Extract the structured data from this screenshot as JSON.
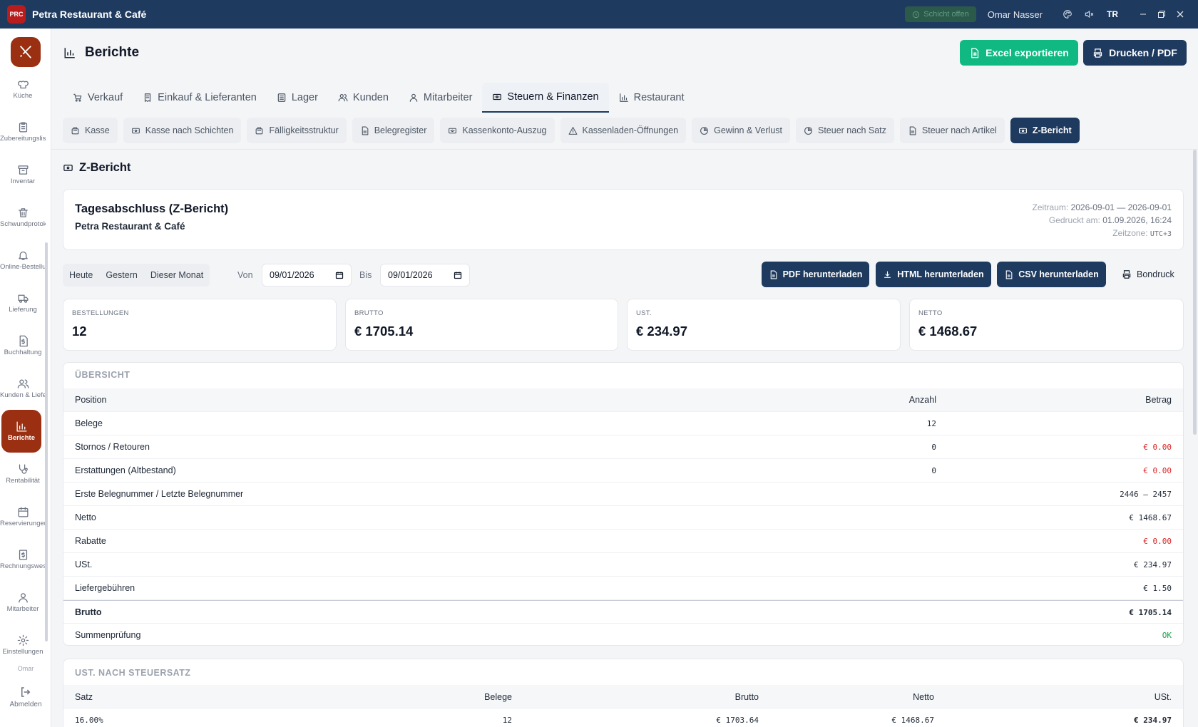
{
  "titlebar": {
    "logo": "PRC",
    "app_title": "Petra Restaurant & Café",
    "shift_status": "Schicht offen",
    "user": "Omar Nasser",
    "lang": "TR"
  },
  "sidebar": {
    "items": [
      {
        "label": "Küche",
        "icon": "chef-hat-icon"
      },
      {
        "label": "Zubereitungsliste",
        "icon": "clipboard-icon"
      },
      {
        "label": "Inventar",
        "icon": "archive-icon"
      },
      {
        "label": "Schwundprotokoll",
        "icon": "trash-icon"
      },
      {
        "label": "Online-Bestellungen",
        "icon": "bell-icon"
      },
      {
        "label": "Lieferung",
        "icon": "truck-icon"
      },
      {
        "label": "Buchhaltung",
        "icon": "dollar-doc-icon"
      },
      {
        "label": "Kunden & Lieferanten",
        "icon": "users-icon"
      },
      {
        "label": "Berichte",
        "icon": "bar-chart-icon",
        "active": true
      },
      {
        "label": "Rentabilität",
        "icon": "stethoscope-icon"
      },
      {
        "label": "Reservierungen",
        "icon": "calendar-icon"
      },
      {
        "label": "Rechnungswesen",
        "icon": "invoice-icon"
      },
      {
        "label": "Mitarbeiter",
        "icon": "staff-icon"
      },
      {
        "label": "Einstellungen",
        "icon": "gear-icon"
      }
    ],
    "user_short": "Omar",
    "logout": "Abmelden"
  },
  "header": {
    "title": "Berichte",
    "excel_btn": "Excel exportieren",
    "print_btn": "Drucken / PDF"
  },
  "tabs": [
    {
      "label": "Verkauf",
      "icon": "cart-icon"
    },
    {
      "label": "Einkauf & Lieferanten",
      "icon": "receipt-icon"
    },
    {
      "label": "Lager",
      "icon": "box-icon"
    },
    {
      "label": "Kunden",
      "icon": "users-icon"
    },
    {
      "label": "Mitarbeiter",
      "icon": "staff-icon"
    },
    {
      "label": "Steuern & Finanzen",
      "icon": "cash-icon",
      "active": true
    },
    {
      "label": "Restaurant",
      "icon": "bar-chart-icon"
    }
  ],
  "subtabs": [
    {
      "label": "Kasse",
      "icon": "register-icon"
    },
    {
      "label": "Kasse nach Schichten",
      "icon": "cash-icon"
    },
    {
      "label": "Fälligkeitsstruktur",
      "icon": "register-icon"
    },
    {
      "label": "Belegregister",
      "icon": "file-icon"
    },
    {
      "label": "Kassenkonto-Auszug",
      "icon": "cash-icon"
    },
    {
      "label": "Kassenladen-Öffnungen",
      "icon": "warning-icon"
    },
    {
      "label": "Gewinn & Verlust",
      "icon": "pie-icon"
    },
    {
      "label": "Steuer nach Satz",
      "icon": "pie-icon"
    },
    {
      "label": "Steuer nach Artikel",
      "icon": "file-icon"
    },
    {
      "label": "Z-Bericht",
      "icon": "cash-icon",
      "active": true
    }
  ],
  "section_title": "Z-Bericht",
  "report": {
    "title": "Tagesabschluss (Z-Bericht)",
    "subtitle": "Petra Restaurant & Café",
    "period_label": "Zeitraum:",
    "period": "2026-09-01 — 2026-09-01",
    "printed_label": "Gedruckt am:",
    "printed": "01.09.2026, 16:24",
    "tz_label": "Zeitzone:",
    "tz": "UTC+3"
  },
  "filters": {
    "quick": [
      "Heute",
      "Gestern",
      "Dieser Monat"
    ],
    "from_label": "Von",
    "from": "09/01/2026",
    "to_label": "Bis",
    "to": "09/01/2026",
    "pdf": "PDF herunterladen",
    "html": "HTML herunterladen",
    "csv": "CSV herunterladen",
    "receipt": "Bondruck"
  },
  "kpis": [
    {
      "label": "BESTELLUNGEN",
      "value": "12"
    },
    {
      "label": "BRUTTO",
      "value": "€ 1705.14"
    },
    {
      "label": "UST.",
      "value": "€ 234.97"
    },
    {
      "label": "NETTO",
      "value": "€ 1468.67"
    }
  ],
  "overview": {
    "title": "ÜBERSICHT",
    "headers": [
      "Position",
      "Anzahl",
      "Betrag"
    ],
    "rows": [
      {
        "label": "Belege",
        "count": "12",
        "amount": "",
        "tone": ""
      },
      {
        "label": "Stornos / Retouren",
        "count": "0",
        "amount": "€ 0.00",
        "tone": "red"
      },
      {
        "label": "Erstattungen (Altbestand)",
        "count": "0",
        "amount": "€ 0.00",
        "tone": "red"
      },
      {
        "label": "Erste Belegnummer / Letzte Belegnummer",
        "count": "",
        "amount": "2446 – 2457",
        "tone": ""
      },
      {
        "label": "Netto",
        "count": "",
        "amount": "€ 1468.67",
        "tone": ""
      },
      {
        "label": "Rabatte",
        "count": "",
        "amount": "€ 0.00",
        "tone": "red"
      },
      {
        "label": "USt.",
        "count": "",
        "amount": "€ 234.97",
        "tone": ""
      },
      {
        "label": "Liefergebühren",
        "count": "",
        "amount": "€ 1.50",
        "tone": ""
      },
      {
        "label": "Brutto",
        "count": "",
        "amount": "€ 1705.14",
        "tone": "bold"
      },
      {
        "label": "Summenprüfung",
        "count": "",
        "amount": "OK",
        "tone": "green"
      }
    ]
  },
  "vat": {
    "title": "UST. NACH STEUERSATZ",
    "headers": [
      "Satz",
      "Belege",
      "Brutto",
      "Netto",
      "USt."
    ],
    "rows": [
      {
        "rate": "16.00%",
        "receipts": "12",
        "gross": "€ 1703.64",
        "net": "€ 1468.67",
        "vat": "€ 234.97"
      }
    ]
  },
  "colors": {
    "navy": "#1e3a5f",
    "brand": "#9a2f12",
    "green": "#10b981",
    "red": "#dc2626"
  }
}
